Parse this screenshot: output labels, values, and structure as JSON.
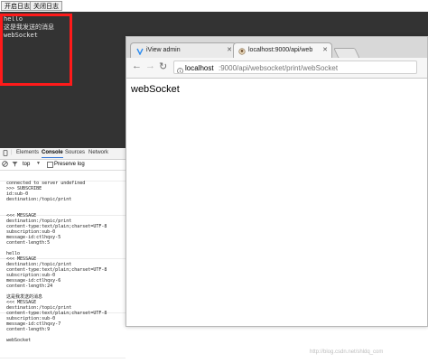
{
  "toolbar": {
    "open_label": "开启日志",
    "close_label": "关闭日志"
  },
  "output": {
    "lines": [
      "hello",
      "这是我发送的消息",
      "webSocket"
    ]
  },
  "devtools": {
    "tabs": [
      "Elements",
      "Console",
      "Sources",
      "Network"
    ],
    "active_tab": "Console",
    "filter_value": "top",
    "preserve_log_label": "Preserve log",
    "log_lines": [
      "connected to server undefined",
      ">>> SUBSCRIBE",
      "id:sub-0",
      "destination:/topic/print",
      "",
      "",
      "<<< MESSAGE",
      "destination:/topic/print",
      "content-type:text/plain;charset=UTF-8",
      "subscription:sub-0",
      "message-id:ctlhqxy-5",
      "content-length:5",
      "",
      "hello",
      "<<< MESSAGE",
      "destination:/topic/print",
      "content-type:text/plain;charset=UTF-8",
      "subscription:sub-0",
      "message-id:ctlhqxy-6",
      "content-length:24",
      "",
      "这是我发送的消息",
      "<<< MESSAGE",
      "destination:/topic/print",
      "content-type:text/plain;charset=UTF-8",
      "subscription:sub-0",
      "message-id:ctlhqxy-7",
      "content-length:9",
      "",
      "webSocket"
    ]
  },
  "browser": {
    "tab1_title": "iView admin",
    "tab2_title": "localhost:9000/api/web",
    "url_host": "localhost",
    "url_rest": ":9000/api/websocket/print/webSocket",
    "page_heading": "webSocket"
  },
  "watermark": "http://blog.csdn.net/shldq_com",
  "colors": {
    "dark_bg": "#333333",
    "highlight_border": "#ff1a1a",
    "active_tab_underline": "#3879d9"
  }
}
